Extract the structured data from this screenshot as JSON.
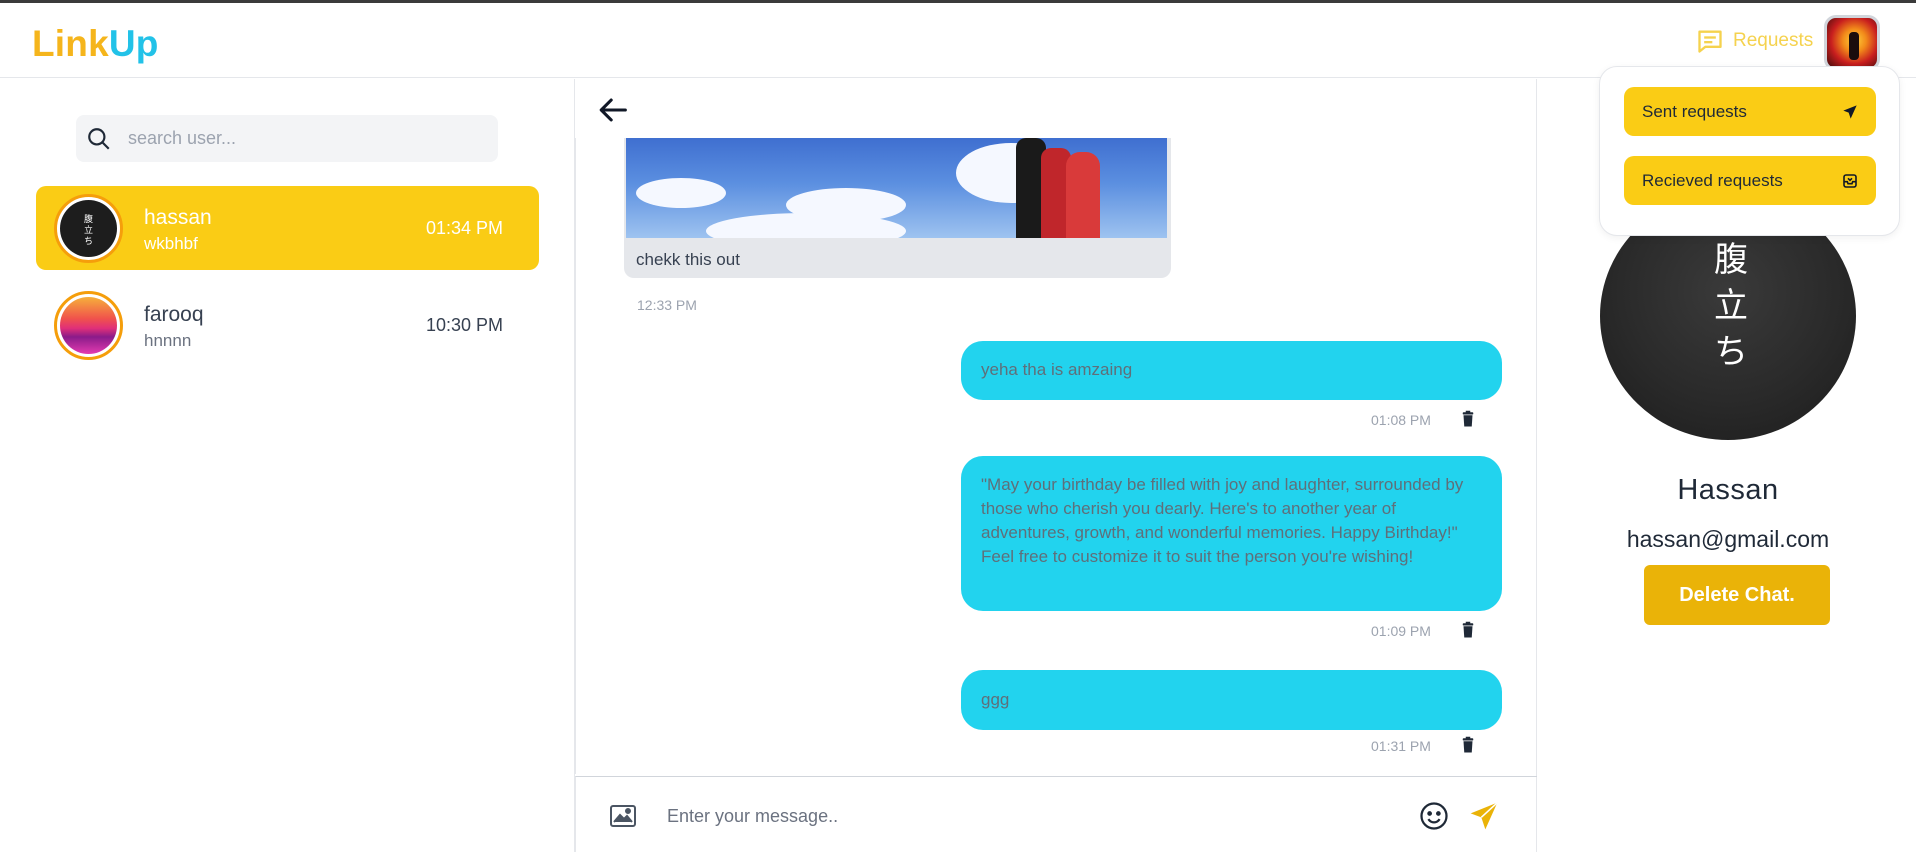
{
  "app": {
    "logo_part1": "Link",
    "logo_part2": "Up"
  },
  "header": {
    "requests_label": "Requests",
    "requests_icon": "chat-bubble-icon",
    "avatar_icon": "user-avatar"
  },
  "sidebar": {
    "search_placeholder": "search user...",
    "contacts": [
      {
        "name": "hassan",
        "last_message": "wkbhbf",
        "time": "01:34 PM",
        "active": true
      },
      {
        "name": "farooq",
        "last_message": "hnnnn",
        "time": "10:30 PM",
        "active": false
      }
    ],
    "hassan_avatar_text": "腹 立 ち"
  },
  "chat": {
    "image_message": {
      "caption": "chekk this out",
      "time": "12:33 PM"
    },
    "messages": [
      {
        "text": "yeha tha is amzaing",
        "time": "01:08 PM"
      },
      {
        "text": "\"May your birthday be filled with joy and laughter, surrounded by those who cherish you dearly. Here's to another year of adventures, growth, and wonderful memories. Happy Birthday!\" Feel free to customize it to suit the person you're wishing!",
        "time": "01:09 PM"
      },
      {
        "text": "ggg",
        "time": "01:31 PM"
      }
    ],
    "composer_placeholder": "Enter your message.."
  },
  "profile": {
    "avatar_kanji": [
      "腹",
      "立",
      "ち"
    ],
    "name": "Hassan",
    "email": "hassan@gmail.com",
    "delete_label": "Delete Chat."
  },
  "dropdown": {
    "sent_label": "Sent requests",
    "received_label": "Recieved requests"
  },
  "colors": {
    "brand_yellow": "#facc15",
    "brand_cyan": "#22d3ee",
    "delete_button": "#eab308"
  }
}
